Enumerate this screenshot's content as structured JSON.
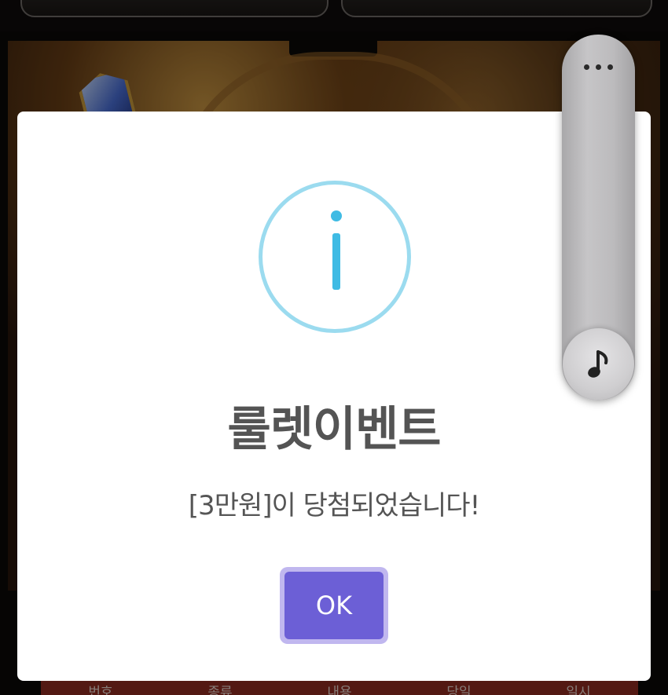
{
  "background": {
    "table_headers": [
      "번호",
      "종류",
      "내용",
      "당일",
      "일시"
    ]
  },
  "modal": {
    "icon": "info-icon",
    "title": "룰렛이벤트",
    "message": "[3만원]이 당첨되었습니다!",
    "ok_label": "OK",
    "accent_color": "#6c5fd6",
    "icon_color": "#3fbbe4"
  },
  "side_panel": {
    "more_icon": "more-horizontal-icon",
    "music_icon": "music-note-icon"
  }
}
